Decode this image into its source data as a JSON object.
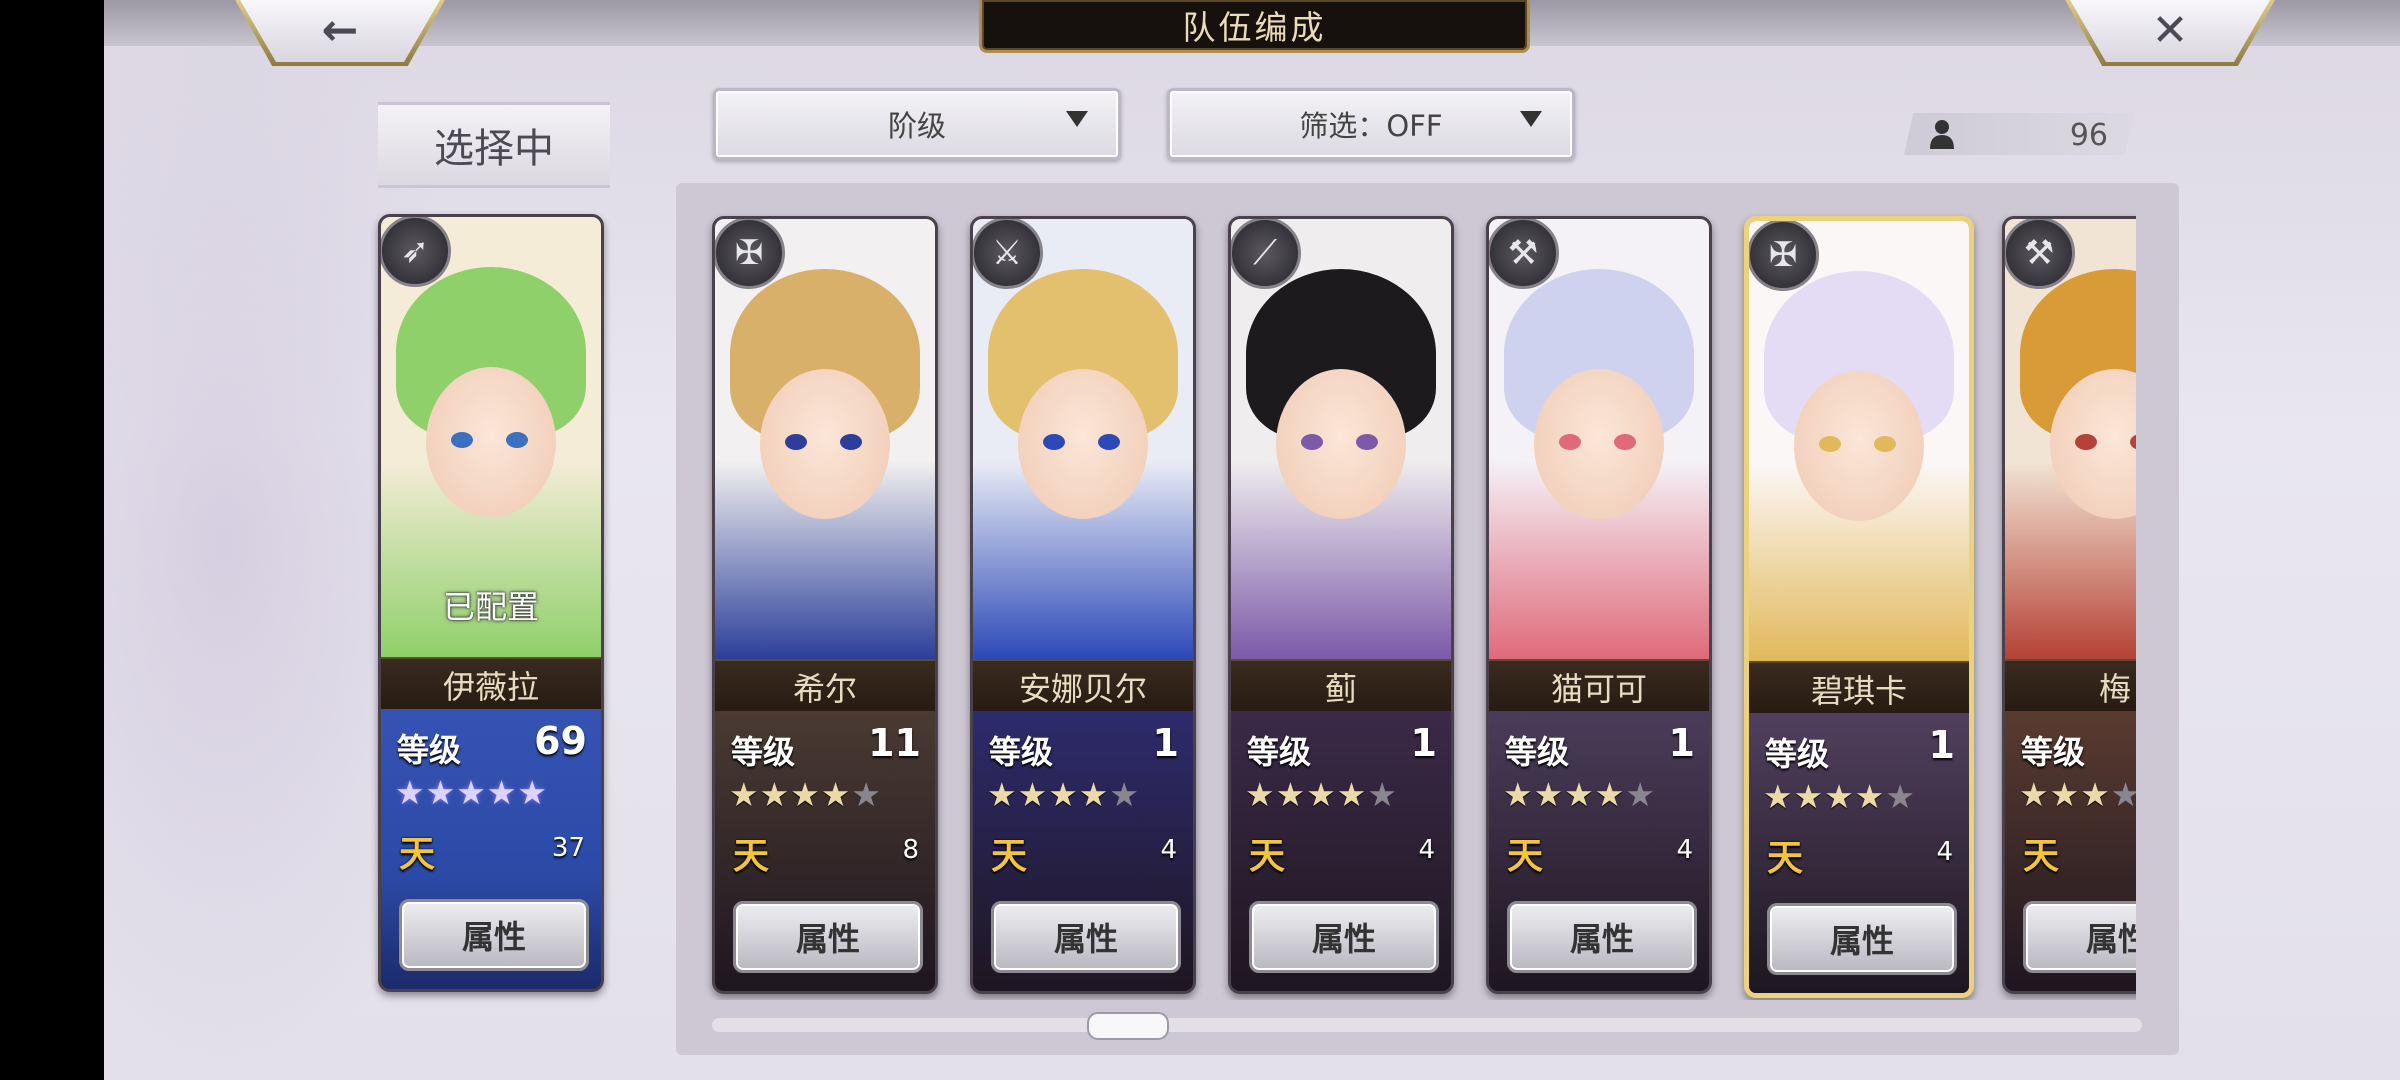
{
  "header": {
    "title": "队伍编成",
    "back_icon": "←",
    "close_icon": "✕"
  },
  "left_panel": {
    "selecting_label": "选择中",
    "card": {
      "name": "伊薇拉",
      "level_label": "等级",
      "level": "69",
      "stars_filled": 5,
      "stars_total": 5,
      "star_style": "rainbow",
      "count": "37",
      "attr_label": "属性",
      "status": "已配置",
      "weapon_icon": "bow-icon",
      "colors": {
        "hair": "#8fd06a",
        "bg": "#f5ecd8",
        "lower": "#2b4aa6"
      }
    }
  },
  "filters": {
    "rank_dropdown": "阶级",
    "filter_dropdown": "筛选：OFF"
  },
  "roster_count": "96",
  "cards": [
    {
      "name": "希尔",
      "level_label": "等级",
      "level": "11",
      "stars_filled": 4,
      "stars_total": 5,
      "count": "8",
      "attr_label": "属性",
      "weapon_icon": "crossbow-icon",
      "highlight": false,
      "colors": {
        "hair": "#d8b06a",
        "bg": "#f2f0f0",
        "lower": "#4a3a32",
        "accent": "#2b3f9a"
      }
    },
    {
      "name": "安娜贝尔",
      "level_label": "等级",
      "level": "1",
      "stars_filled": 4,
      "stars_total": 5,
      "count": "4",
      "attr_label": "属性",
      "weapon_icon": "sword-icon",
      "highlight": false,
      "colors": {
        "hair": "#e3c06e",
        "bg": "#e9ecf5",
        "lower": "#2e2b6e",
        "accent": "#2c49b8"
      }
    },
    {
      "name": "蓟",
      "level_label": "等级",
      "level": "1",
      "stars_filled": 4,
      "stars_total": 5,
      "count": "4",
      "attr_label": "属性",
      "weapon_icon": "katana-icon",
      "highlight": false,
      "colors": {
        "hair": "#1d1a1e",
        "bg": "#efedee",
        "lower": "#3b2a48",
        "accent": "#7c5aa8"
      }
    },
    {
      "name": "猫可可",
      "level_label": "等级",
      "level": "1",
      "stars_filled": 4,
      "stars_total": 5,
      "count": "4",
      "attr_label": "属性",
      "weapon_icon": "axe-icon",
      "highlight": false,
      "colors": {
        "hair": "#cfd2ef",
        "bg": "#f4f1f7",
        "lower": "#4b3d5a",
        "accent": "#e06a7a"
      }
    },
    {
      "name": "碧琪卡",
      "level_label": "等级",
      "level": "1",
      "stars_filled": 4,
      "stars_total": 5,
      "count": "4",
      "attr_label": "属性",
      "weapon_icon": "crossbow-icon",
      "highlight": true,
      "colors": {
        "hair": "#e4dcf5",
        "bg": "#fbf7f6",
        "lower": "#51405e",
        "accent": "#e2b95a"
      }
    },
    {
      "name": "梅",
      "level_label": "等级",
      "level": "",
      "stars_filled": 3,
      "stars_total": 5,
      "count": "",
      "attr_label": "属性",
      "weapon_icon": "hammer-icon",
      "highlight": false,
      "colors": {
        "hair": "#d99a38",
        "bg": "#f2e4d4",
        "lower": "#5a3b30",
        "accent": "#b54236"
      }
    }
  ]
}
